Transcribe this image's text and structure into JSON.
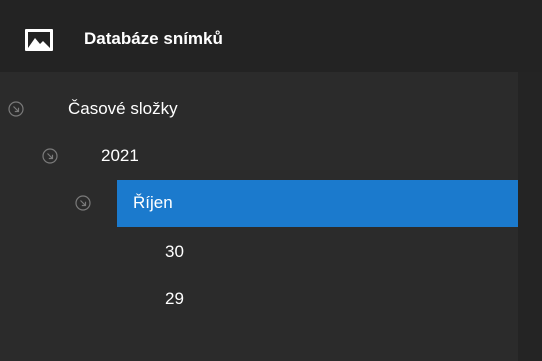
{
  "panel": {
    "title": "Databáze snímků",
    "icon": "image-icon"
  },
  "tree": {
    "items": [
      {
        "label": "Časové složky",
        "expander": "expanded-arrow-icon",
        "level": 0,
        "selected": false
      },
      {
        "label": "2021",
        "expander": "expanded-arrow-icon",
        "level": 1,
        "selected": false
      },
      {
        "label": "Říjen",
        "expander": "expanded-arrow-icon",
        "level": 2,
        "selected": true
      },
      {
        "label": "30",
        "level": 3,
        "selected": false
      },
      {
        "label": "29",
        "level": 3,
        "selected": false
      }
    ]
  },
  "colors": {
    "selection": "#1b7acd",
    "header_background": "#232323",
    "panel_background": "#2b2b2b",
    "text": "#ffffff",
    "expander": "#7a7a7a"
  }
}
